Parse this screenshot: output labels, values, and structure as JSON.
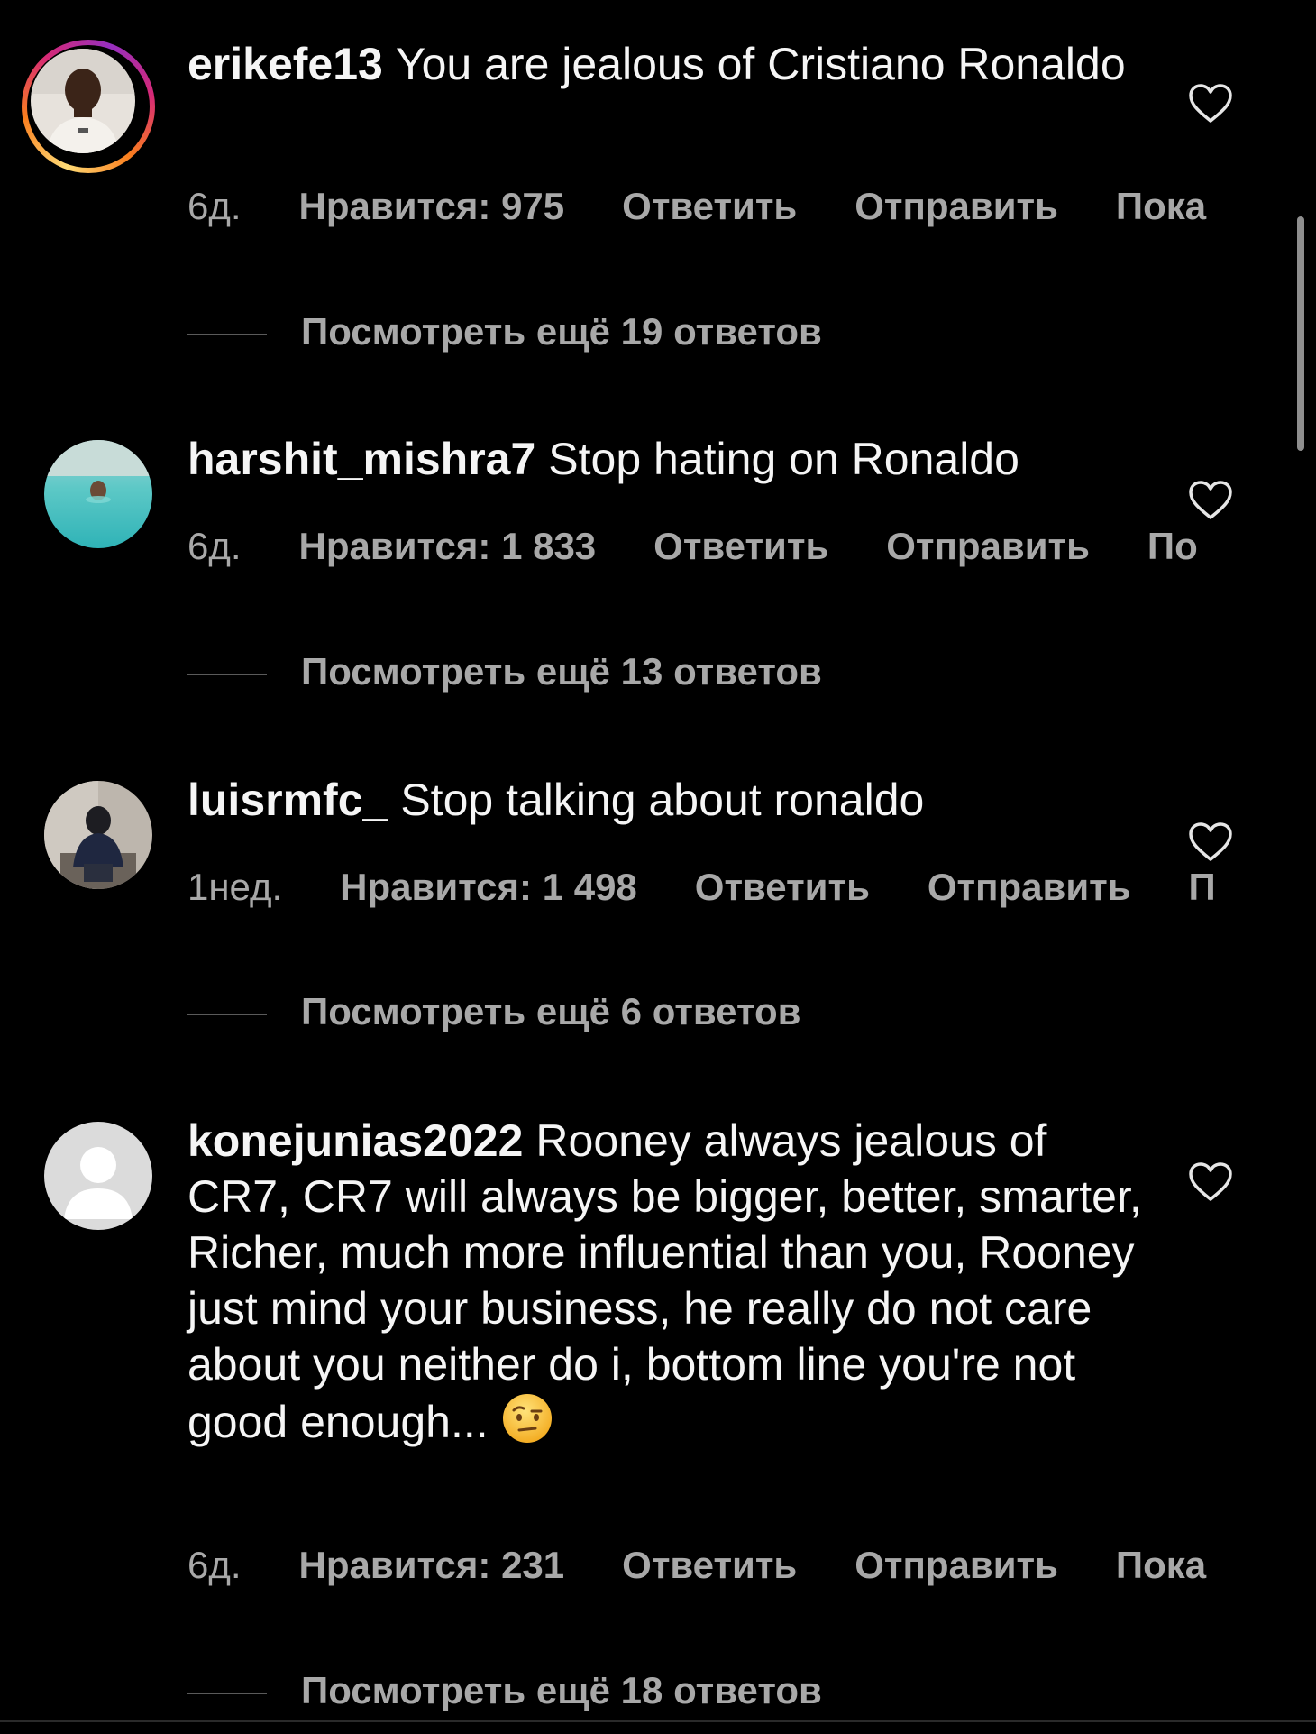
{
  "comments": [
    {
      "username": "erikefe13",
      "text": "You are jealous of Cristiano Ronaldo",
      "time": "6д.",
      "likes": "Нравится: 975",
      "reply": "Ответить",
      "send": "Отправить",
      "more": "Пока",
      "view_replies": "Посмотреть ещё 19 ответов"
    },
    {
      "username": "harshit_mishra7",
      "text": "Stop hating on Ronaldo",
      "time": "6д.",
      "likes": "Нравится: 1 833",
      "reply": "Ответить",
      "send": "Отправить",
      "more": "По",
      "view_replies": "Посмотреть ещё 13 ответов"
    },
    {
      "username": "luisrmfc_",
      "text": "Stop talking about ronaldo",
      "time": "1нед.",
      "likes": "Нравится: 1 498",
      "reply": "Ответить",
      "send": "Отправить",
      "more": "П",
      "view_replies": "Посмотреть ещё 6 ответов"
    },
    {
      "username": "konejunias2022",
      "text": "Rooney always jealous of CR7, CR7 will always be bigger, better, smarter, Richer, much more influential than you, Rooney just mind your business, he really do not care about you neither do i, bottom line you're not good enough...",
      "emoji": "raised-eyebrow-emoji",
      "time": "6д.",
      "likes": "Нравится: 231",
      "reply": "Ответить",
      "send": "Отправить",
      "more": "Пока",
      "view_replies": "Посмотреть ещё 18 ответов"
    }
  ],
  "colors": {
    "background": "#000000",
    "primary_text": "#f5f5f5",
    "secondary_text": "#a8a8a8"
  }
}
